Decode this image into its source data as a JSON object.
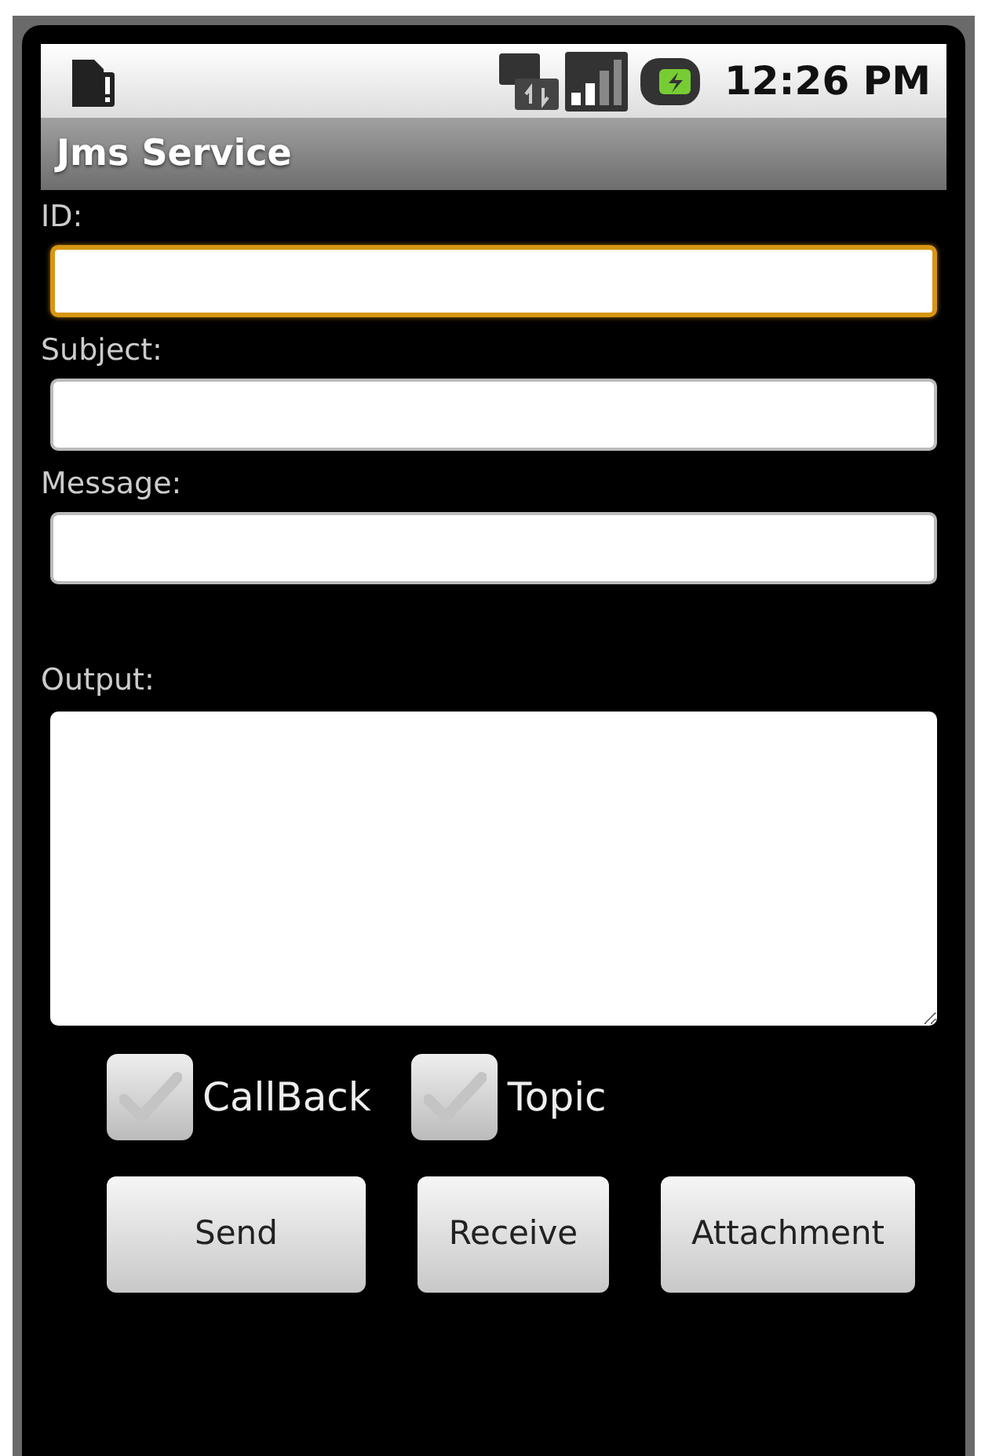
{
  "status_bar": {
    "time": "12:26 PM"
  },
  "title": "Jms Service",
  "fields": [
    {
      "label": "ID:",
      "focused": true
    },
    {
      "label": "Subject:",
      "focused": false
    },
    {
      "label": "Message:",
      "focused": false
    }
  ],
  "output": {
    "label": "Output:"
  },
  "checkboxes": [
    {
      "label": "CallBack",
      "checked": false
    },
    {
      "label": "Topic",
      "checked": false
    }
  ],
  "buttons": [
    "Send",
    "Receive",
    "Attachment"
  ]
}
